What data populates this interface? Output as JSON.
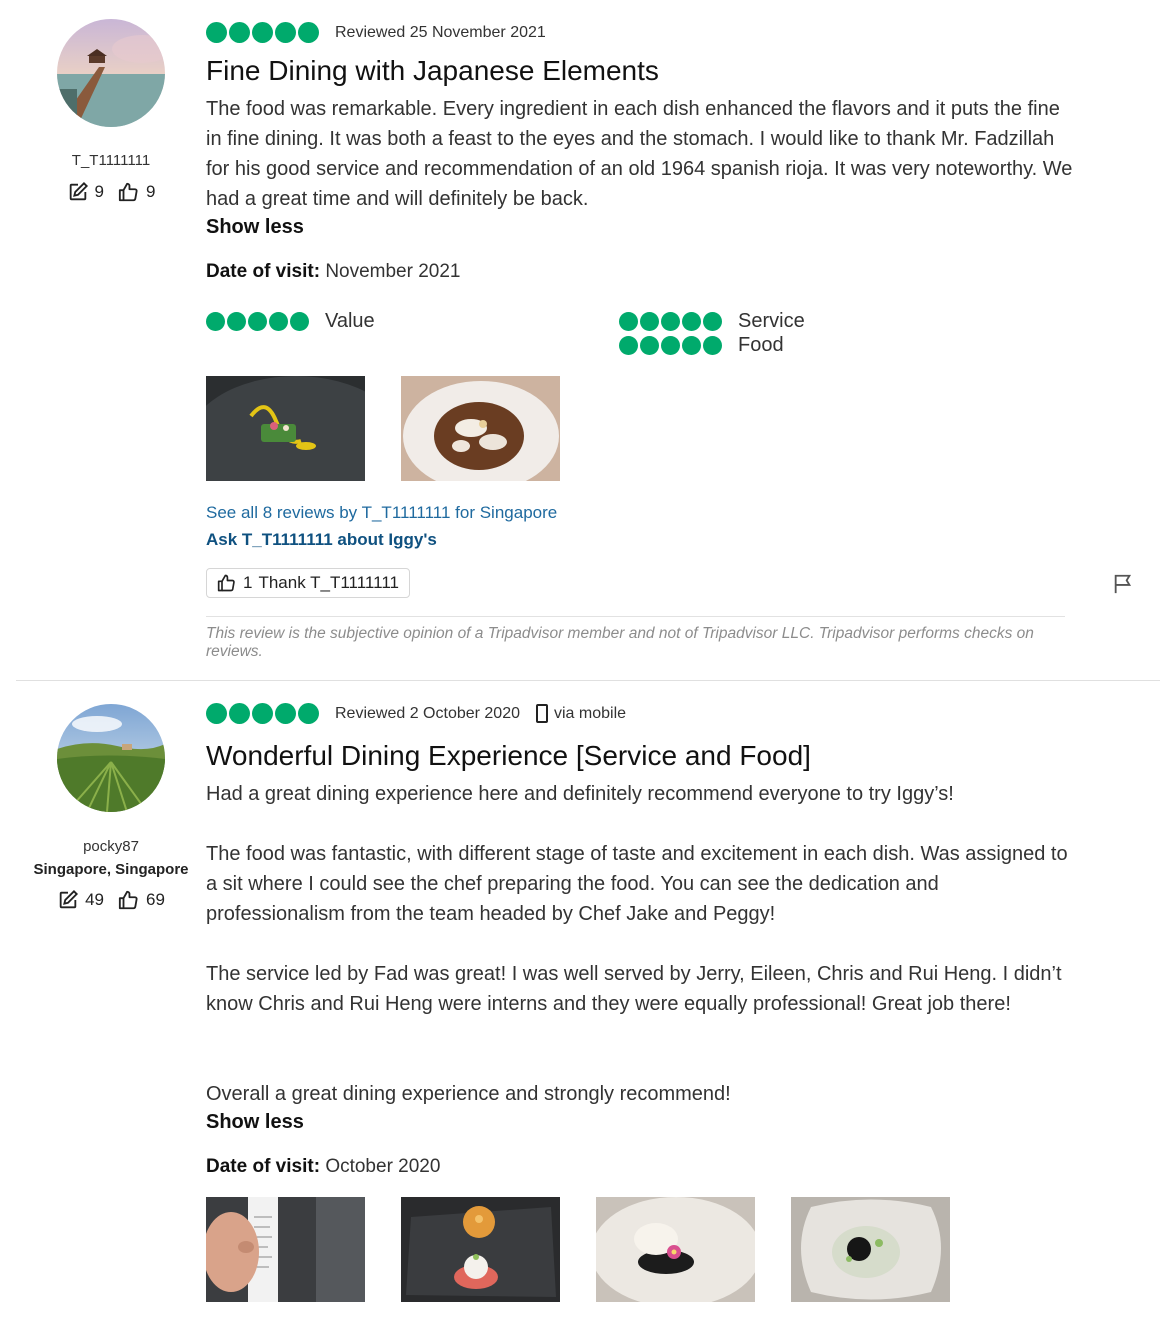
{
  "colors": {
    "bubble": "#00aa6c",
    "link": "#1f6a9f"
  },
  "reviews": [
    {
      "user": {
        "name": "T_T1111111",
        "contributions": "9",
        "helpful_votes": "9",
        "location": ""
      },
      "rating": 5,
      "reviewed": "Reviewed 25 November 2021",
      "title": "Fine Dining with Japanese Elements",
      "paragraphs": [
        "The food was remarkable. Every ingredient in each dish enhanced the flavors and it puts the fine in fine dining. It was both a feast to the eyes and the stomach. I would like to thank Mr. Fadzillah for his good service and recommendation of an old 1964 spanish rioja. It was very noteworthy. We had a great time and will definitely be back."
      ],
      "show_less": "Show less",
      "visit_label": "Date of visit:",
      "visit_value": "November 2021",
      "sub_ratings": [
        {
          "label": "Value",
          "score": 5
        },
        {
          "label": "Service",
          "score": 5
        },
        {
          "label": "Food",
          "score": 5
        }
      ],
      "see_all_link": "See all 8 reviews by T_T1111111 for Singapore",
      "ask_link": "Ask T_T1111111 about Iggy's",
      "thank_count": "1",
      "thank_label": "Thank T_T1111111",
      "disclaimer": "This review is the subjective opinion of a Tripadvisor member and not of Tripadvisor LLC. Tripadvisor performs checks on reviews.",
      "icons": [
        "edit-icon",
        "thumbs-up-icon",
        "flag-icon"
      ]
    },
    {
      "user": {
        "name": "pocky87",
        "location": "Singapore, Singapore",
        "contributions": "49",
        "helpful_votes": "69"
      },
      "rating": 5,
      "reviewed": "Reviewed 2 October 2020",
      "via": "via mobile",
      "title": "Wonderful Dining Experience [Service and Food]",
      "paragraphs": [
        "Had a great dining experience here and definitely recommend everyone to try Iggy’s!",
        "The food was fantastic, with different stage of taste and excitement in each dish. Was assigned to a sit where I could see the chef preparing the food. You can see the dedication and professionalism from the team headed by Chef Jake and Peggy!",
        "The service led by Fad was great! I was well served by Jerry, Eileen, Chris and Rui Heng. I didn’t know Chris and Rui Heng were interns and they were equally professional! Great job there!",
        "Overall a great dining experience and strongly recommend!"
      ],
      "show_less": "Show less",
      "visit_label": "Date of visit:",
      "visit_value": "October 2020",
      "icons": [
        "edit-icon",
        "thumbs-up-icon",
        "phone-icon"
      ]
    }
  ]
}
